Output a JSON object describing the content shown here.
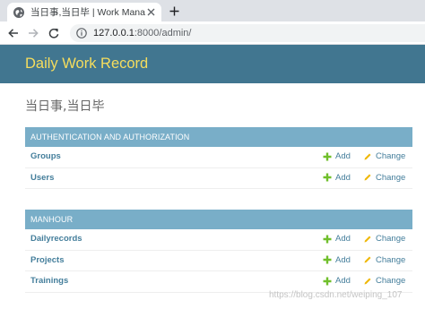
{
  "browser": {
    "tab_title": "当日事,当日毕 | Work Manageme",
    "url_host": "127.0.0.1",
    "url_path": ":8000/admin/"
  },
  "admin": {
    "site_title": "Daily Work Record",
    "page_title": "当日事,当日毕",
    "add_label": "Add",
    "change_label": "Change",
    "modules": [
      {
        "caption": "AUTHENTICATION AND AUTHORIZATION",
        "models": [
          {
            "name": "Groups"
          },
          {
            "name": "Users"
          }
        ]
      },
      {
        "caption": "MANHOUR",
        "models": [
          {
            "name": "Dailyrecords"
          },
          {
            "name": "Projects"
          },
          {
            "name": "Trainings"
          }
        ]
      }
    ]
  },
  "watermark": "https://blog.csdn.net/weiping_107",
  "colors": {
    "header_bg": "#417690",
    "site_title": "#f5dd5d",
    "module_head_bg": "#79aec8",
    "link": "#447e9b",
    "add_icon": "#70bf2b",
    "change_icon": "#efb80b"
  }
}
